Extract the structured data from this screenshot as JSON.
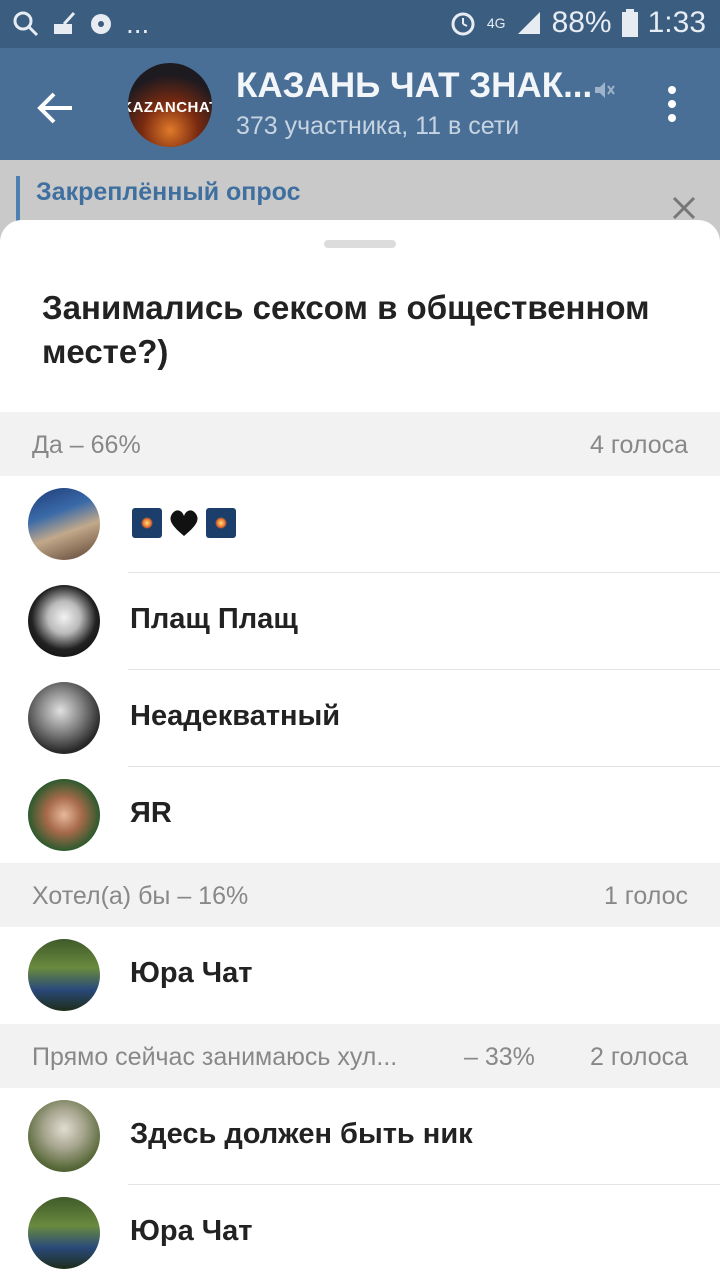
{
  "status_bar": {
    "network": "4G",
    "battery": "88%",
    "time": "1:33",
    "more_label": "..."
  },
  "header": {
    "title": "КАЗАНЬ ЧАТ ЗНАК...",
    "subtitle": "373 участника, 11 в сети",
    "avatar_text": "KAZANCHAT"
  },
  "pinned": {
    "title": "Закреплённый опрос"
  },
  "poll": {
    "question": "Занимались сексом в общественном месте?)",
    "options": [
      {
        "label": "Да – 66%",
        "count": "4 голоса",
        "voters": [
          {
            "name": ""
          },
          {
            "name": "Плащ Плащ"
          },
          {
            "name": "Неадекватный"
          },
          {
            "name": "ЯR"
          }
        ]
      },
      {
        "label": "Хотел(а) бы – 16%",
        "count": "1 голос",
        "voters": [
          {
            "name": "Юра Чат"
          }
        ]
      },
      {
        "label": "Прямо сейчас занимаюсь хул...",
        "percent": "– 33%",
        "count": "2 голоса",
        "voters": [
          {
            "name": "Здесь должен быть ник"
          },
          {
            "name": "Юра Чат"
          }
        ]
      }
    ]
  },
  "colors": {
    "status_bar": "#3a5d80",
    "app_bar": "#4a6f97",
    "section_bg": "#f2f2f2",
    "accent": "#3f6f9f"
  }
}
